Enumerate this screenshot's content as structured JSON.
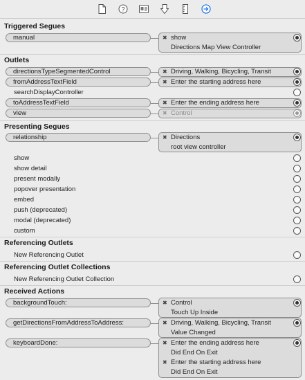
{
  "toolbar": {
    "icons": [
      "file-inspector-icon",
      "quick-help-icon",
      "identity-inspector-icon",
      "attributes-inspector-icon",
      "size-inspector-icon",
      "connections-inspector-icon"
    ],
    "accent": "#2b7ae6"
  },
  "triggered_segues": {
    "title": "Triggered Segues",
    "rows": [
      {
        "source": "manual",
        "targets": [
          "show",
          "Directions Map View Controller"
        ]
      }
    ]
  },
  "outlets": {
    "title": "Outlets",
    "rows": [
      {
        "source": "directionsTypeSegmentedControl",
        "target": "Driving, Walking, Bicycling, Transit"
      },
      {
        "source": "fromAddressTextField",
        "target": "Enter the starting address here"
      },
      {
        "source": "searchDisplayController"
      },
      {
        "source": "toAddressTextField",
        "target": "Enter the ending address here"
      },
      {
        "source": "view",
        "target": "Control"
      }
    ]
  },
  "presenting_segues": {
    "title": "Presenting Segues",
    "relationship": {
      "source": "relationship",
      "targets": [
        "Directions",
        "root view controller"
      ]
    },
    "items": [
      "show",
      "show detail",
      "present modally",
      "popover presentation",
      "embed",
      "push (deprecated)",
      "modal (deprecated)",
      "custom"
    ]
  },
  "referencing_outlets": {
    "title": "Referencing Outlets",
    "item": "New Referencing Outlet"
  },
  "referencing_outlet_collections": {
    "title": "Referencing Outlet Collections",
    "item": "New Referencing Outlet Collection"
  },
  "received_actions": {
    "title": "Received Actions",
    "rows": [
      {
        "source": "backgroundTouch:",
        "targets": [
          [
            "Control",
            "Touch Up Inside"
          ]
        ]
      },
      {
        "source": "getDirectionsFromAddressToAddress:",
        "targets": [
          [
            "Driving, Walking, Bicycling, Transit",
            "Value Changed"
          ]
        ]
      },
      {
        "source": "keyboardDone:",
        "targets": [
          [
            "Enter the ending address here",
            "Did End On Exit"
          ],
          [
            "Enter the starting address here",
            "Did End On Exit"
          ]
        ]
      }
    ]
  },
  "remove_glyph": "✖"
}
